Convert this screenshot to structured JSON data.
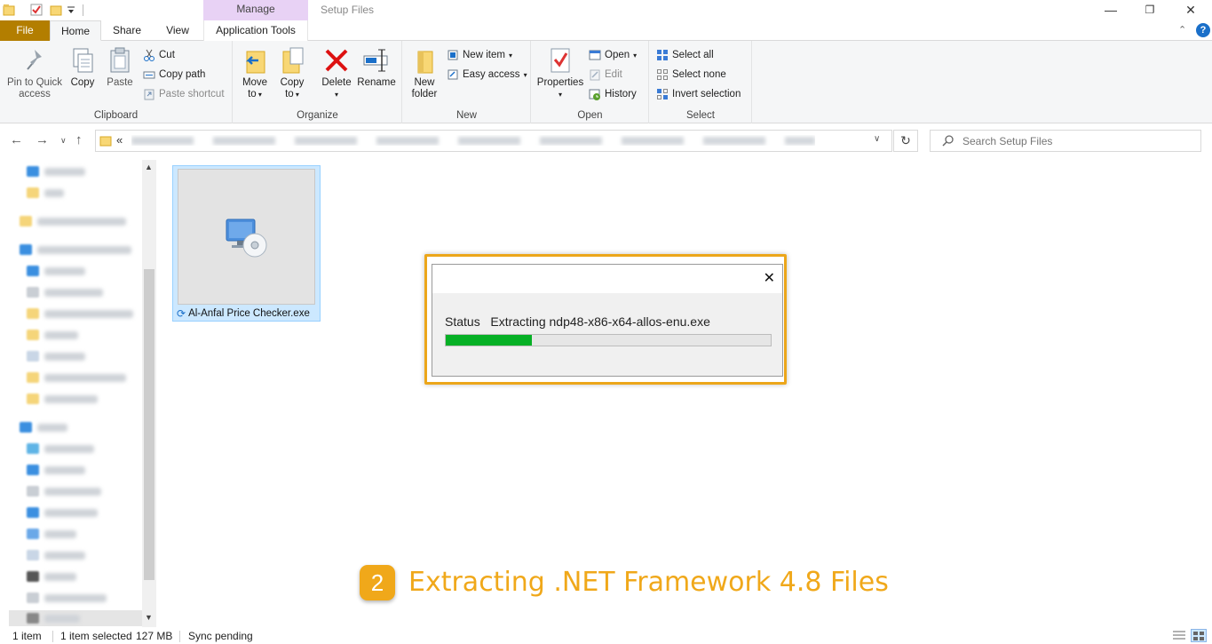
{
  "window": {
    "title": "Setup Files",
    "contextual_tab": "Manage",
    "controls": {
      "minimize": "—",
      "restore": "❐",
      "close": "✕"
    }
  },
  "ribbon_tabs": [
    {
      "label": "File"
    },
    {
      "label": "Home"
    },
    {
      "label": "Share"
    },
    {
      "label": "View"
    },
    {
      "label": "Application Tools"
    }
  ],
  "ribbon": {
    "clipboard": {
      "label": "Clipboard",
      "pin_quick_access": "Pin to Quick access",
      "copy": "Copy",
      "paste": "Paste",
      "cut": "Cut",
      "copy_path": "Copy path",
      "paste_shortcut": "Paste shortcut"
    },
    "organize": {
      "label": "Organize",
      "move_to": "Move to",
      "copy_to": "Copy to",
      "delete": "Delete",
      "rename": "Rename"
    },
    "new": {
      "label": "New",
      "new_folder": "New folder",
      "new_item": "New item",
      "easy_access": "Easy access"
    },
    "open": {
      "label": "Open",
      "properties": "Properties",
      "open": "Open",
      "edit": "Edit",
      "history": "History"
    },
    "select": {
      "label": "Select",
      "select_all": "Select all",
      "select_none": "Select none",
      "invert_selection": "Invert selection"
    }
  },
  "address": {
    "overflow": "«",
    "search_placeholder": "Search Setup Files"
  },
  "file": {
    "name": "Al-Anfal Price Checker.exe"
  },
  "dialog": {
    "close": "✕",
    "status_label": "Status",
    "status_text": "Extracting ndp48-x86-x64-allos-enu.exe",
    "progress": 0.265
  },
  "caption": {
    "step": "2",
    "text": "Extracting .NET Framework 4.8 Files"
  },
  "statusbar": {
    "count": "1 item",
    "selected": "1 item selected",
    "size": "127 MB",
    "sync": "Sync pending"
  },
  "colors": {
    "file_tab": "#b37e00",
    "manage_tab": "#e8d2f5",
    "accent_orange": "#f0a81a",
    "progress_green": "#06b025",
    "selection": "#cce8ff"
  }
}
